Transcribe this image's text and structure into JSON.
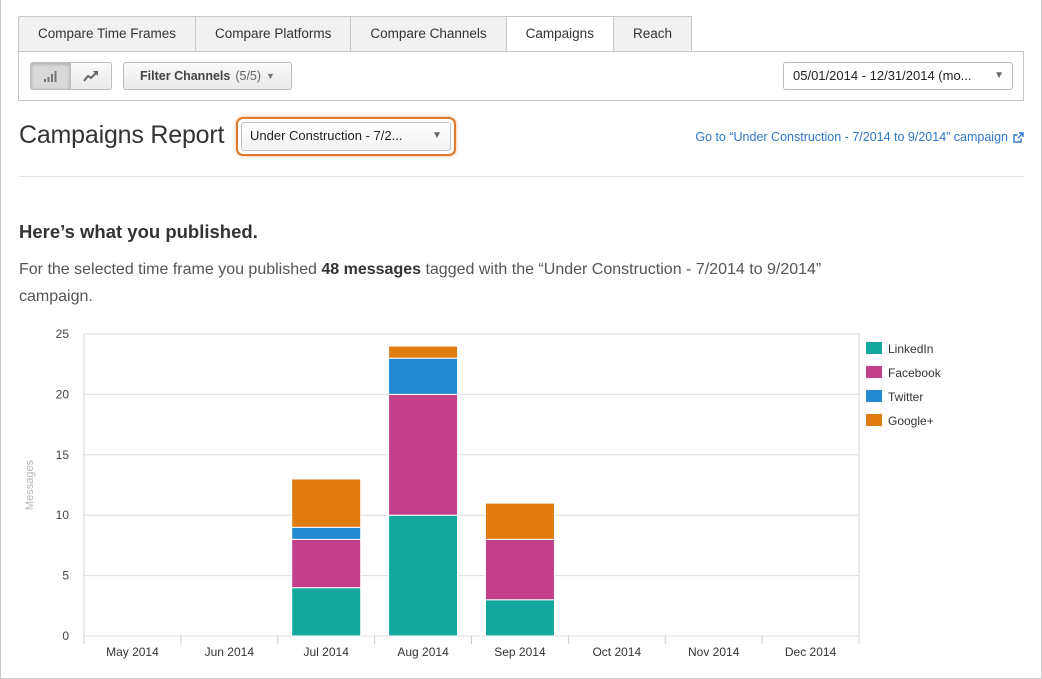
{
  "tabs": [
    {
      "label": "Compare Time Frames",
      "active": false
    },
    {
      "label": "Compare Platforms",
      "active": false
    },
    {
      "label": "Compare Channels",
      "active": false
    },
    {
      "label": "Campaigns",
      "active": true
    },
    {
      "label": "Reach",
      "active": false
    }
  ],
  "toolbar": {
    "view_buttons": [
      {
        "icon": "bar-chart-icon",
        "active": true
      },
      {
        "icon": "trend-line-icon",
        "active": false
      }
    ],
    "filter_label": "Filter Channels",
    "filter_count": "(5/5)",
    "date_range": "05/01/2014 - 12/31/2014 (mo..."
  },
  "header": {
    "title": "Campaigns Report",
    "campaign_select": "Under Construction - 7/2...",
    "campaign_link": "Go to “Under Construction - 7/2014 to 9/2014” campaign",
    "link_icon": "external-link-icon"
  },
  "summary": {
    "heading": "Here’s what you published.",
    "text_before": "For the selected time frame you published ",
    "count": "48 messages",
    "text_after": " tagged with the “Under Construction - 7/2014 to 9/2014” campaign."
  },
  "chart_data": {
    "type": "bar",
    "stacked": true,
    "categories": [
      "May 2014",
      "Jun 2014",
      "Jul 2014",
      "Aug 2014",
      "Sep 2014",
      "Oct 2014",
      "Nov 2014",
      "Dec 2014"
    ],
    "series": [
      {
        "name": "LinkedIn",
        "color": "#13a89e",
        "values": [
          0,
          0,
          4,
          10,
          3,
          0,
          0,
          0
        ]
      },
      {
        "name": "Facebook",
        "color": "#c2408b",
        "values": [
          0,
          0,
          4,
          10,
          5,
          0,
          0,
          0
        ]
      },
      {
        "name": "Twitter",
        "color": "#2389d3",
        "values": [
          0,
          0,
          1,
          3,
          0,
          0,
          0,
          0
        ]
      },
      {
        "name": "Google+",
        "color": "#e07b0f",
        "values": [
          0,
          0,
          4,
          1,
          3,
          0,
          0,
          0
        ]
      }
    ],
    "ylabel": "Messages",
    "ylim": [
      0,
      25
    ],
    "yticks": [
      0,
      5,
      10,
      15,
      20,
      25
    ],
    "grid": true,
    "legend": "right"
  }
}
